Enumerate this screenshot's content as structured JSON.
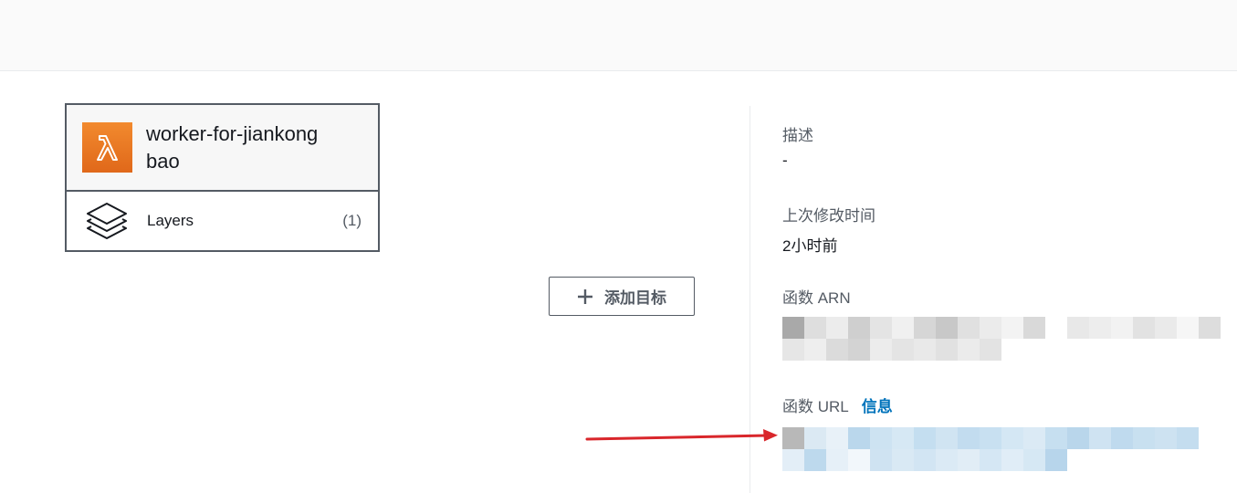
{
  "function": {
    "name": "worker-for-jiankongbao",
    "icon": "lambda-icon",
    "layers_label": "Layers",
    "layers_count": "(1)"
  },
  "diagram": {
    "add_target_label": "添加目标"
  },
  "details": {
    "description_label": "描述",
    "description_value": "-",
    "last_modified_label": "上次修改时间",
    "last_modified_value": "2小时前",
    "arn_label": "函数 ARN",
    "url_label": "函数 URL",
    "url_info_link": "信息"
  },
  "colors": {
    "accent_orange": "#e8761f",
    "link_blue": "#0073bb",
    "arrow_red": "#d9262b"
  }
}
